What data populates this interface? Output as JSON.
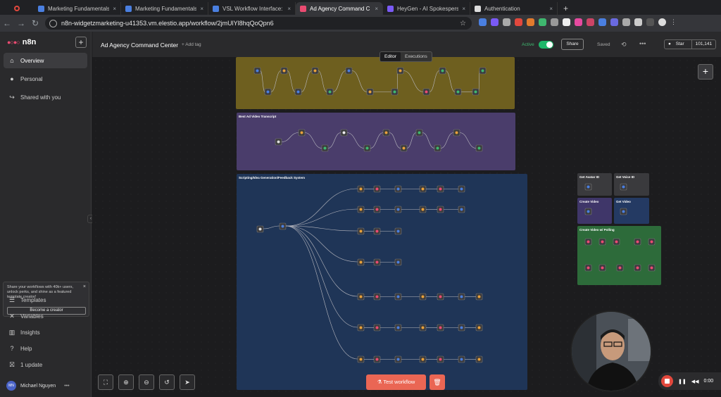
{
  "browser": {
    "tabs": [
      {
        "title": "Marketing Fundamentals Vid",
        "color": "#4a7fe0"
      },
      {
        "title": "Marketing Fundamentals Out",
        "color": "#4a7fe0"
      },
      {
        "title": "VSL Workflow Interface: VSL",
        "color": "#4a7fe0"
      },
      {
        "title": "Ad Agency Command C",
        "color": "#ea4b71",
        "active": true
      },
      {
        "title": "HeyGen - AI Spokesperson V",
        "color": "#7a5af5"
      },
      {
        "title": "Authentication",
        "color": "#dddddd"
      }
    ],
    "url": "n8n-widgetzmarketing-u41353.vm.elestio.app/workflow/2jmUlYl8hqQoQpn6"
  },
  "sidebar": {
    "brand": "n8n",
    "nav_top": [
      {
        "label": "Overview",
        "icon": "home-icon",
        "glyph": "⌂"
      },
      {
        "label": "Personal",
        "icon": "user-icon",
        "glyph": "●"
      },
      {
        "label": "Shared with you",
        "icon": "share-icon",
        "glyph": "↪"
      }
    ],
    "promo": {
      "text": "Share your workflows with 40k+ users, unlock perks, and shine as a featured template creator!",
      "button": "Become a creator"
    },
    "nav_bottom": [
      {
        "label": "Templates",
        "icon": "templates-icon",
        "glyph": "☰"
      },
      {
        "label": "Variables",
        "icon": "variables-icon",
        "glyph": "✕"
      },
      {
        "label": "Insights",
        "icon": "insights-icon",
        "glyph": "▥"
      },
      {
        "label": "Help",
        "icon": "help-icon",
        "glyph": "?"
      },
      {
        "label": "1 update",
        "icon": "update-icon",
        "glyph": "⛝"
      }
    ],
    "user": {
      "initials": "MN",
      "name": "Michael Nguyen"
    }
  },
  "header": {
    "workflow_name": "Ad Agency Command Center",
    "add_tag": "+ Add tag",
    "tabs": [
      "Editor",
      "Executions"
    ],
    "active_label": "Active",
    "share": "Share",
    "saved": "Saved",
    "star": "Star",
    "star_count": "101,141"
  },
  "canvas": {
    "stickies": [
      {
        "title": "",
        "color": "#6e5f1f"
      },
      {
        "title": "Best Ad Video Transcript",
        "color": "#4a3d6b"
      },
      {
        "title": "Scripting/Idea Generation/Feedback System",
        "color": "#1f3557"
      },
      {
        "title": "Get Avatar ID",
        "color": "#3a3a3d"
      },
      {
        "title": "Get Voice ID",
        "color": "#3a3a3d"
      },
      {
        "title": "Create Video",
        "color": "#3f3669"
      },
      {
        "title": "Get Video",
        "color": "#243a63"
      },
      {
        "title": "Create Video w/ Polling",
        "color": "#2d6b3a"
      }
    ],
    "test_button": "Test workflow"
  },
  "recorder": {
    "time": "0:00"
  },
  "colors": {
    "accent": "#ea4b71",
    "primary_button": "#ea6654",
    "active_green": "#1fb76a"
  }
}
